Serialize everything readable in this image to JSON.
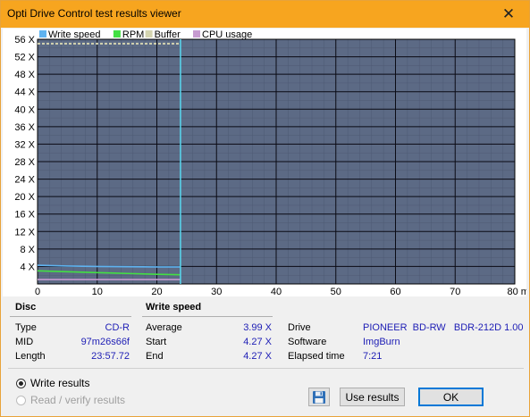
{
  "window": {
    "title": "Opti Drive Control test results viewer",
    "close_glyph": "✕"
  },
  "chart_data": {
    "type": "line",
    "title": "",
    "xlabel": "",
    "ylabel": "",
    "x_unit": "min",
    "xlim": [
      0,
      80
    ],
    "ylim": [
      0,
      56
    ],
    "x_ticks": [
      0,
      10,
      20,
      30,
      40,
      50,
      60,
      70,
      80
    ],
    "y_ticks": [
      4,
      8,
      12,
      16,
      20,
      24,
      28,
      32,
      36,
      40,
      44,
      48,
      52,
      56
    ],
    "y_tick_suffix": " X",
    "grid": true,
    "legend_position": "top-left",
    "legend": [
      {
        "name": "Write speed",
        "color": "#5FB3F0"
      },
      {
        "name": "RPM",
        "color": "#43E043"
      },
      {
        "name": "Buffer",
        "color": "#D4D4B0"
      },
      {
        "name": "CPU usage",
        "color": "#C79BD0"
      }
    ],
    "end_marker_x": 23.96,
    "series": [
      {
        "name": "Write speed",
        "color": "#5FB3F0",
        "x": [
          0,
          5,
          10,
          15,
          20,
          23.96
        ],
        "y": [
          4.27,
          4.1,
          4.0,
          3.95,
          3.9,
          3.9
        ]
      },
      {
        "name": "RPM",
        "color": "#43E043",
        "x": [
          0,
          5,
          10,
          15,
          20,
          23.96
        ],
        "y": [
          3.0,
          2.8,
          2.6,
          2.4,
          2.2,
          2.1
        ]
      },
      {
        "name": "Buffer",
        "color": "#D4D4B0",
        "x": [
          0,
          23.96
        ],
        "y": [
          55,
          55
        ]
      },
      {
        "name": "CPU usage",
        "color": "#C79BD0",
        "x": [
          0,
          23.96
        ],
        "y": [
          1,
          1
        ]
      }
    ],
    "background_color": "#5C6A85",
    "grid_color": "#0A0A14"
  },
  "disc": {
    "title": "Disc",
    "type_label": "Type",
    "type_value": "CD-R",
    "mid_label": "MID",
    "mid_value": "97m26s66f",
    "length_label": "Length",
    "length_value": "23:57.72"
  },
  "write_speed": {
    "title": "Write speed",
    "average_label": "Average",
    "average_value": "3.99 X",
    "start_label": "Start",
    "start_value": "4.27 X",
    "end_label": "End",
    "end_value": "4.27 X"
  },
  "drive": {
    "drive_label": "Drive",
    "drive_value": "PIONEER  BD-RW   BDR-212D 1.00",
    "software_label": "Software",
    "software_value": "ImgBurn",
    "elapsed_label": "Elapsed time",
    "elapsed_value": "7:21"
  },
  "options": {
    "write_results": "Write results",
    "read_verify": "Read / verify results",
    "selected": "write_results"
  },
  "buttons": {
    "save_icon": "floppy-disk-icon",
    "use_results": "Use results",
    "ok": "OK"
  }
}
